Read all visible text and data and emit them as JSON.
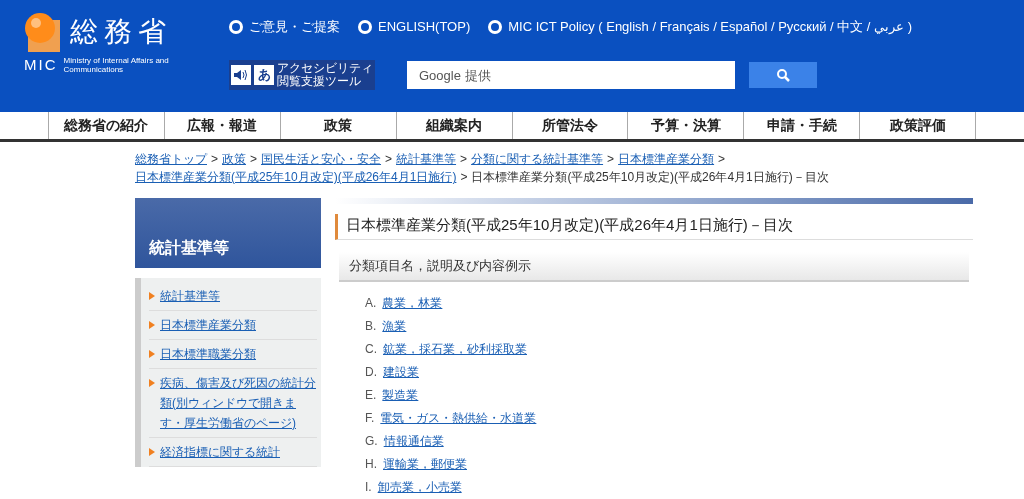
{
  "header": {
    "logo_title": "総務省",
    "logo_abbr": "MIC",
    "logo_subtitle": "Ministry of Internal Affairs and Communications",
    "top_links": [
      {
        "label": "ご意見・ご提案"
      },
      {
        "label": "ENGLISH(TOP)"
      },
      {
        "label": "MIC ICT Policy ( English / Français / Español / Русский / 中文 / عربي )"
      }
    ],
    "accessibility": {
      "glyph": "あ",
      "lines": [
        "アクセシビリティ",
        "閲覧支援ツール"
      ]
    },
    "search": {
      "placeholder": "Google 提供"
    }
  },
  "nav": [
    "総務省の紹介",
    "広報・報道",
    "政策",
    "組織案内",
    "所管法令",
    "予算・決算",
    "申請・手続",
    "政策評価"
  ],
  "breadcrumb": {
    "links": [
      "総務省トップ",
      "政策",
      "国民生活と安心・安全",
      "統計基準等",
      "分類に関する統計基準等",
      "日本標準産業分類",
      "日本標準産業分類(平成25年10月改定)(平成26年4月1日施行)"
    ],
    "separator": ">",
    "current": "日本標準産業分類(平成25年10月改定)(平成26年4月1日施行)－目次"
  },
  "sidebar": {
    "title": "統計基準等",
    "items": [
      "統計基準等",
      "日本標準産業分類",
      "日本標準職業分類",
      "疾病、傷害及び死因の統計分類(別ウィンドウで開きます・厚生労働省のページ)",
      "経済指標に関する統計"
    ]
  },
  "main": {
    "title": "日本標準産業分類(平成25年10月改定)(平成26年4月1日施行)－目次",
    "section": "分類項目名，説明及び内容例示",
    "items": [
      {
        "letter": "A.",
        "label": "農業，林業"
      },
      {
        "letter": "B.",
        "label": "漁業"
      },
      {
        "letter": "C.",
        "label": "鉱業，採石業，砂利採取業"
      },
      {
        "letter": "D.",
        "label": "建設業"
      },
      {
        "letter": "E.",
        "label": "製造業"
      },
      {
        "letter": "F.",
        "label": "電気・ガス・熱供給・水道業"
      },
      {
        "letter": "G.",
        "label": "情報通信業"
      },
      {
        "letter": "H.",
        "label": "運輸業，郵便業"
      },
      {
        "letter": "I.",
        "label": "卸売業，小売業"
      }
    ]
  }
}
